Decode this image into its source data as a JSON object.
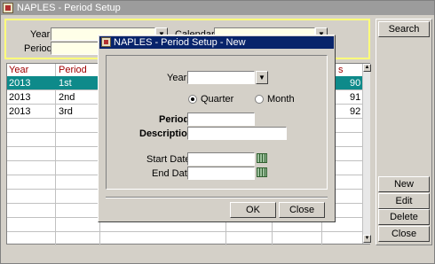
{
  "window": {
    "title": "NAPLES - Period Setup"
  },
  "filter": {
    "year_label": "Year",
    "period_label": "Period",
    "calendar_label": "Calendar"
  },
  "side_buttons": {
    "search": "Search",
    "new": "New",
    "edit": "Edit",
    "delete": "Delete",
    "close": "Close"
  },
  "grid": {
    "headers": [
      "Year",
      "Period",
      "s"
    ],
    "rows": [
      {
        "year": "2013",
        "period": "1st",
        "tail": "90"
      },
      {
        "year": "2013",
        "period": "2nd",
        "tail": "91"
      },
      {
        "year": "2013",
        "period": "3rd",
        "tail": "92"
      }
    ]
  },
  "dialog": {
    "title": "NAPLES - Period Setup - New",
    "year_label": "Year",
    "quarter_label": "Quarter",
    "month_label": "Month",
    "period_label": "Period",
    "description_label": "Description",
    "start_date_label": "Start Date",
    "end_date_label": "End Date",
    "ok_label": "OK",
    "close_label": "Close"
  }
}
